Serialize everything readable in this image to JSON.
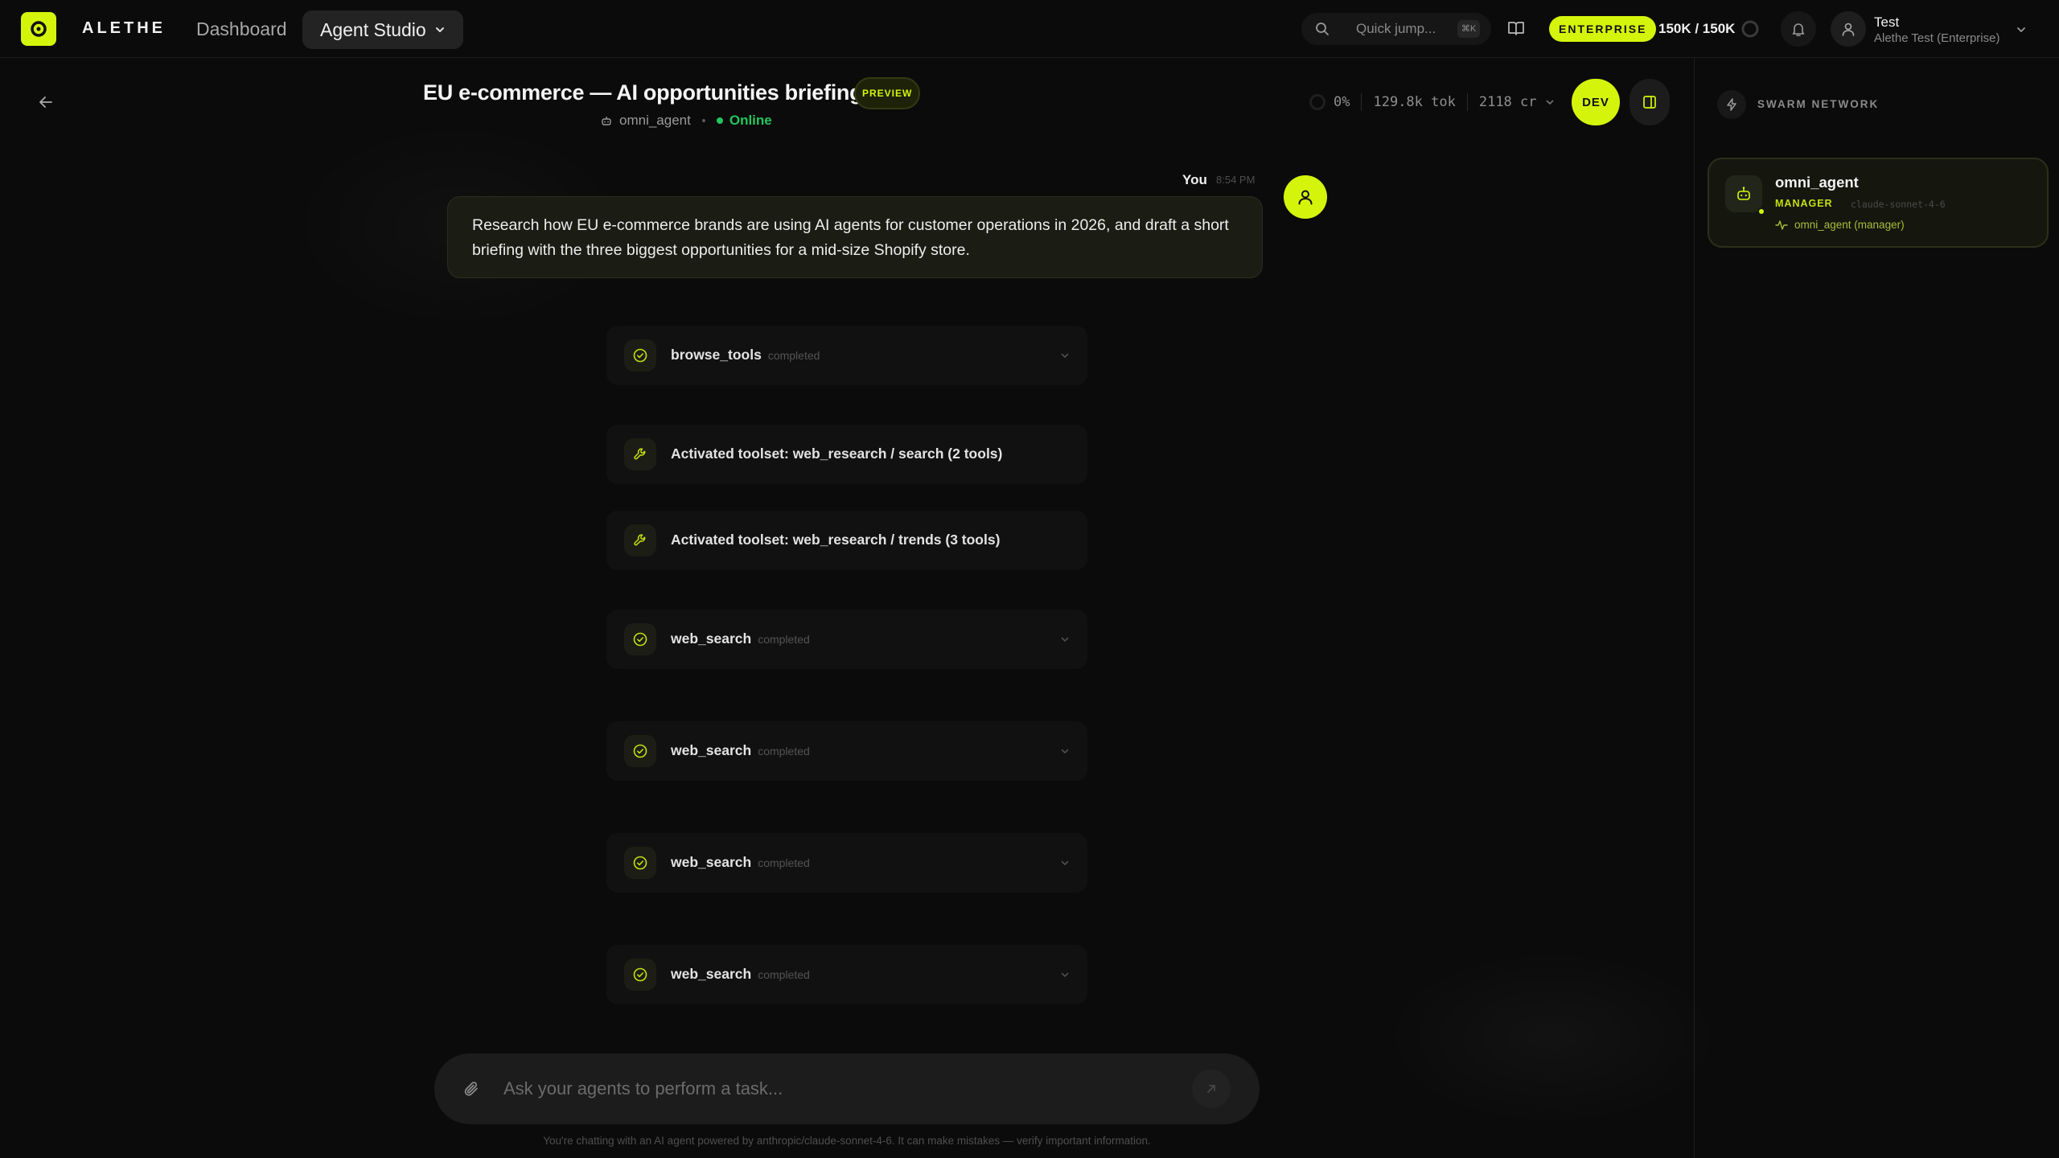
{
  "header": {
    "brand": "ALETHE",
    "nav_dashboard": "Dashboard",
    "nav_studio": "Agent Studio",
    "quick_jump": "Quick jump...",
    "quick_jump_kbd": "⌘K",
    "plan_badge": "ENTERPRISE",
    "credits": "150K / 150K",
    "user_name": "Test",
    "user_org": "Alethe Test (Enterprise)"
  },
  "session": {
    "title": "EU e-commerce — AI opportunities briefing",
    "badge": "PREVIEW",
    "agent": "omni_agent",
    "status": "Online",
    "stats": {
      "context_pct": "0%",
      "tokens": "129.8k tok",
      "credits": "2118 cr"
    },
    "mode_button": "DEV"
  },
  "message": {
    "author": "You",
    "time": "8:54 PM",
    "text": "Research how EU e-commerce brands are using AI agents for customer operations in 2026, and draft a short briefing with the three biggest opportunities for a mid-size Shopify store."
  },
  "steps": [
    {
      "name": "browse_tools",
      "status": "completed",
      "icon": "check-circle-icon"
    },
    {
      "name": "Activated toolset: web_research / search (2 tools)",
      "status": "",
      "icon": "wrench-icon"
    },
    {
      "name": "Activated toolset: web_research / trends (3 tools)",
      "status": "",
      "icon": "wrench-icon"
    },
    {
      "name": "web_search",
      "status": "completed",
      "icon": "check-circle-icon"
    },
    {
      "name": "web_search",
      "status": "completed",
      "icon": "check-circle-icon"
    },
    {
      "name": "web_search",
      "status": "completed",
      "icon": "check-circle-icon"
    },
    {
      "name": "web_search",
      "status": "completed",
      "icon": "check-circle-icon"
    }
  ],
  "composer": {
    "placeholder": "Ask your agents to perform a task...",
    "value": "",
    "disclaimer": "You're chatting with an AI agent powered by anthropic/claude-sonnet-4-6. It can make mistakes — verify important information."
  },
  "swarm": {
    "title": "SWARM NETWORK",
    "agents": [
      {
        "name": "omni_agent",
        "role": "MANAGER",
        "model": "claude-sonnet-4-6",
        "activity": "omni_agent (manager)"
      }
    ]
  },
  "colors": {
    "accent": "#d4f50b",
    "background": "#0b0b0b",
    "online": "#22c55e"
  }
}
